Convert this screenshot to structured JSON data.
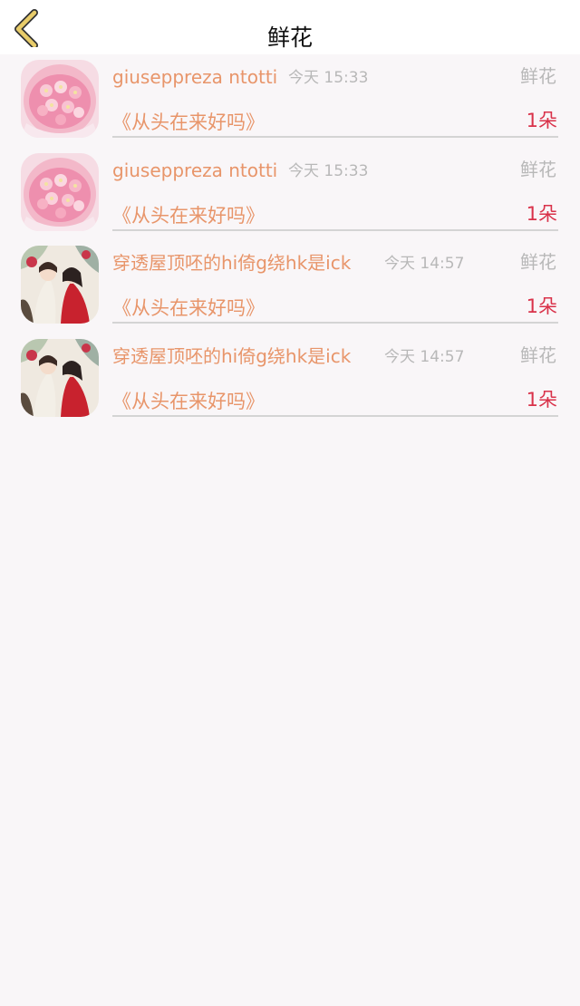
{
  "header": {
    "title": "鲜花",
    "back_icon": "chevron-left-icon",
    "back_icon_color": "#e0c060"
  },
  "colors": {
    "name": "#e8956a",
    "meta": "#b8b8b8",
    "count": "#d9324a",
    "background": "#f9f6f8"
  },
  "records": [
    {
      "avatar": "pink-flower-avatar",
      "name": "giuseppreza ntotti",
      "time": "今天 15:33",
      "type": "鲜花",
      "book": "《从头在来好吗》",
      "count": "1朵"
    },
    {
      "avatar": "pink-flower-avatar",
      "name": "giuseppreza ntotti",
      "time": "今天 15:33",
      "type": "鲜花",
      "book": "《从头在来好吗》",
      "count": "1朵"
    },
    {
      "avatar": "anime-couple-avatar",
      "name": "穿透屋顶呸的hi倚g绕hk是ick",
      "time": "今天 14:57",
      "type": "鲜花",
      "book": "《从头在来好吗》",
      "count": "1朵"
    },
    {
      "avatar": "anime-couple-avatar",
      "name": "穿透屋顶呸的hi倚g绕hk是ick",
      "time": "今天 14:57",
      "type": "鲜花",
      "book": "《从头在来好吗》",
      "count": "1朵"
    }
  ]
}
